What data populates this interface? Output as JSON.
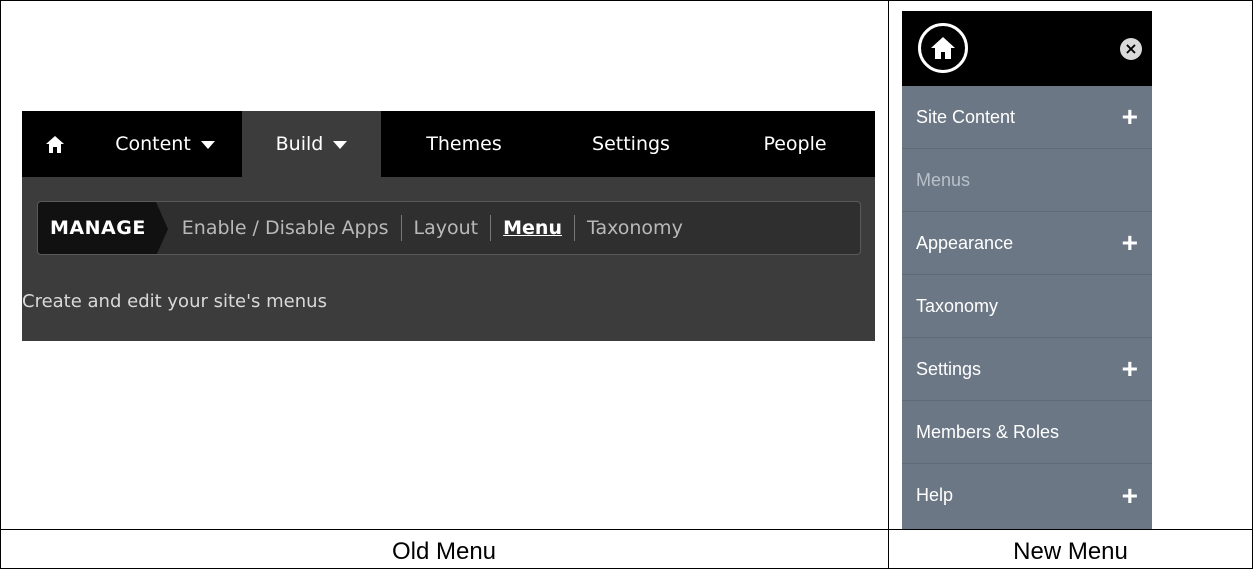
{
  "old_menu": {
    "nav_items": [
      "Content",
      "Build",
      "Themes",
      "Settings",
      "People"
    ],
    "active_nav": "Build",
    "subnav": {
      "label": "MANAGE",
      "items": [
        "Enable / Disable Apps",
        "Layout",
        "Menu",
        "Taxonomy"
      ],
      "active": "Menu"
    },
    "description": "Create and edit your site's menus",
    "icons": {
      "home": "home-icon",
      "dropdown": "caret-down-icon"
    }
  },
  "new_menu": {
    "items": [
      {
        "label": "Site Content",
        "expandable": true
      },
      {
        "label": "Menus",
        "expandable": false
      },
      {
        "label": "Appearance",
        "expandable": true
      },
      {
        "label": "Taxonomy",
        "expandable": false
      },
      {
        "label": "Settings",
        "expandable": true
      },
      {
        "label": "Members & Roles",
        "expandable": false
      },
      {
        "label": "Help",
        "expandable": true
      }
    ],
    "expand_symbol": "+",
    "close_symbol": "×",
    "icons": {
      "home": "home-icon",
      "close": "close-icon"
    }
  },
  "captions": {
    "old": "Old Menu",
    "new": "New Menu"
  },
  "colors": {
    "old_bg": "#3c3c3c",
    "old_topbar": "#000000",
    "new_bg": "#6b7785"
  }
}
